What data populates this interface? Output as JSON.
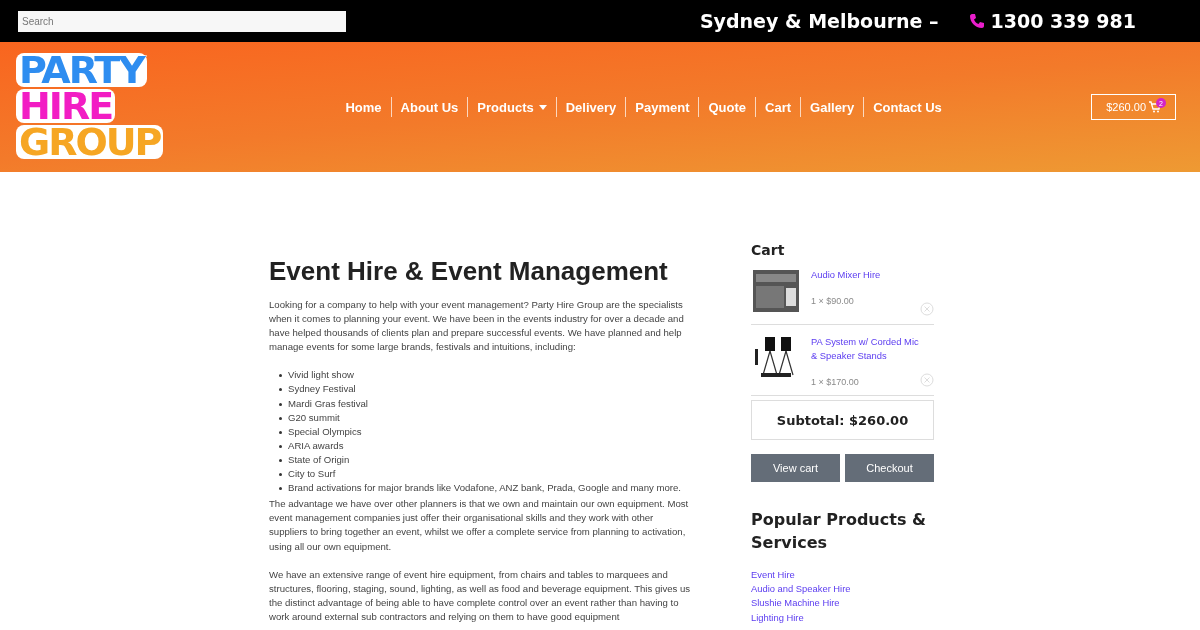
{
  "top_bar": {
    "search": {
      "placeholder": "Search"
    },
    "location": "Sydney & Melbourne –",
    "phone": "1300 339 981"
  },
  "header": {
    "logo": [
      "PARTY",
      "HIRE",
      "GROUP"
    ],
    "nav": [
      {
        "label": "Home",
        "has_dropdown": false
      },
      {
        "label": "About Us",
        "has_dropdown": false
      },
      {
        "label": "Products",
        "has_dropdown": true
      },
      {
        "label": "Delivery",
        "has_dropdown": false
      },
      {
        "label": "Payment",
        "has_dropdown": false
      },
      {
        "label": "Quote",
        "has_dropdown": false
      },
      {
        "label": "Cart",
        "has_dropdown": false
      },
      {
        "label": "Gallery",
        "has_dropdown": false
      },
      {
        "label": "Contact Us",
        "has_dropdown": false
      }
    ],
    "cart_button": {
      "total": "$260.00",
      "count": "2"
    }
  },
  "main": {
    "title": "Event Hire & Event Management",
    "intro": "Looking for a company to help with your event management? Party Hire Group are the specialists when it comes to planning your event. We have been in the events industry for over a decade and have helped thousands of clients plan and prepare successful events. We have planned and help manage events for some large brands, festivals and intuitions, including:",
    "list": [
      "Vivid light show",
      "Sydney Festival",
      "Mardi Gras festival",
      "G20 summit",
      "Special Olympics",
      "ARIA awards",
      "State of Origin",
      "City to Surf",
      "Brand activations for major brands like Vodafone, ANZ bank, Prada, Google and many more."
    ],
    "paragraphs": [
      "The advantage we have over other planners is that we own and maintain our own equipment. Most event management companies just offer their organisational skills and they work with other suppliers to bring together an event, whilst we offer a complete service from planning to activation, using all our own equipment.",
      "We have an extensive range of event hire equipment, from chairs and tables to marquees and structures, flooring, staging, sound, lighting, as well as food and beverage equipment. This gives us the distinct advantage of being able to have complete control over an event rather than having to work around external sub contractors and relying on them to have good equipment"
    ]
  },
  "sidebar": {
    "cart_title": "Cart",
    "cart_items": [
      {
        "kind": "mixer",
        "name": "Audio Mixer Hire",
        "quantity": "1 × $90.00"
      },
      {
        "kind": "speakers",
        "name": "PA System w/ Corded Mic & Speaker Stands",
        "quantity": "1 × $170.00"
      }
    ],
    "subtotal": "Subtotal: $260.00",
    "buttons": [
      "View cart",
      "Checkout"
    ],
    "popular_title": "Popular Products & Services",
    "popular_links": [
      "Event Hire",
      "Audio and Speaker Hire",
      "Slushie Machine Hire",
      "Lighting Hire"
    ]
  }
}
